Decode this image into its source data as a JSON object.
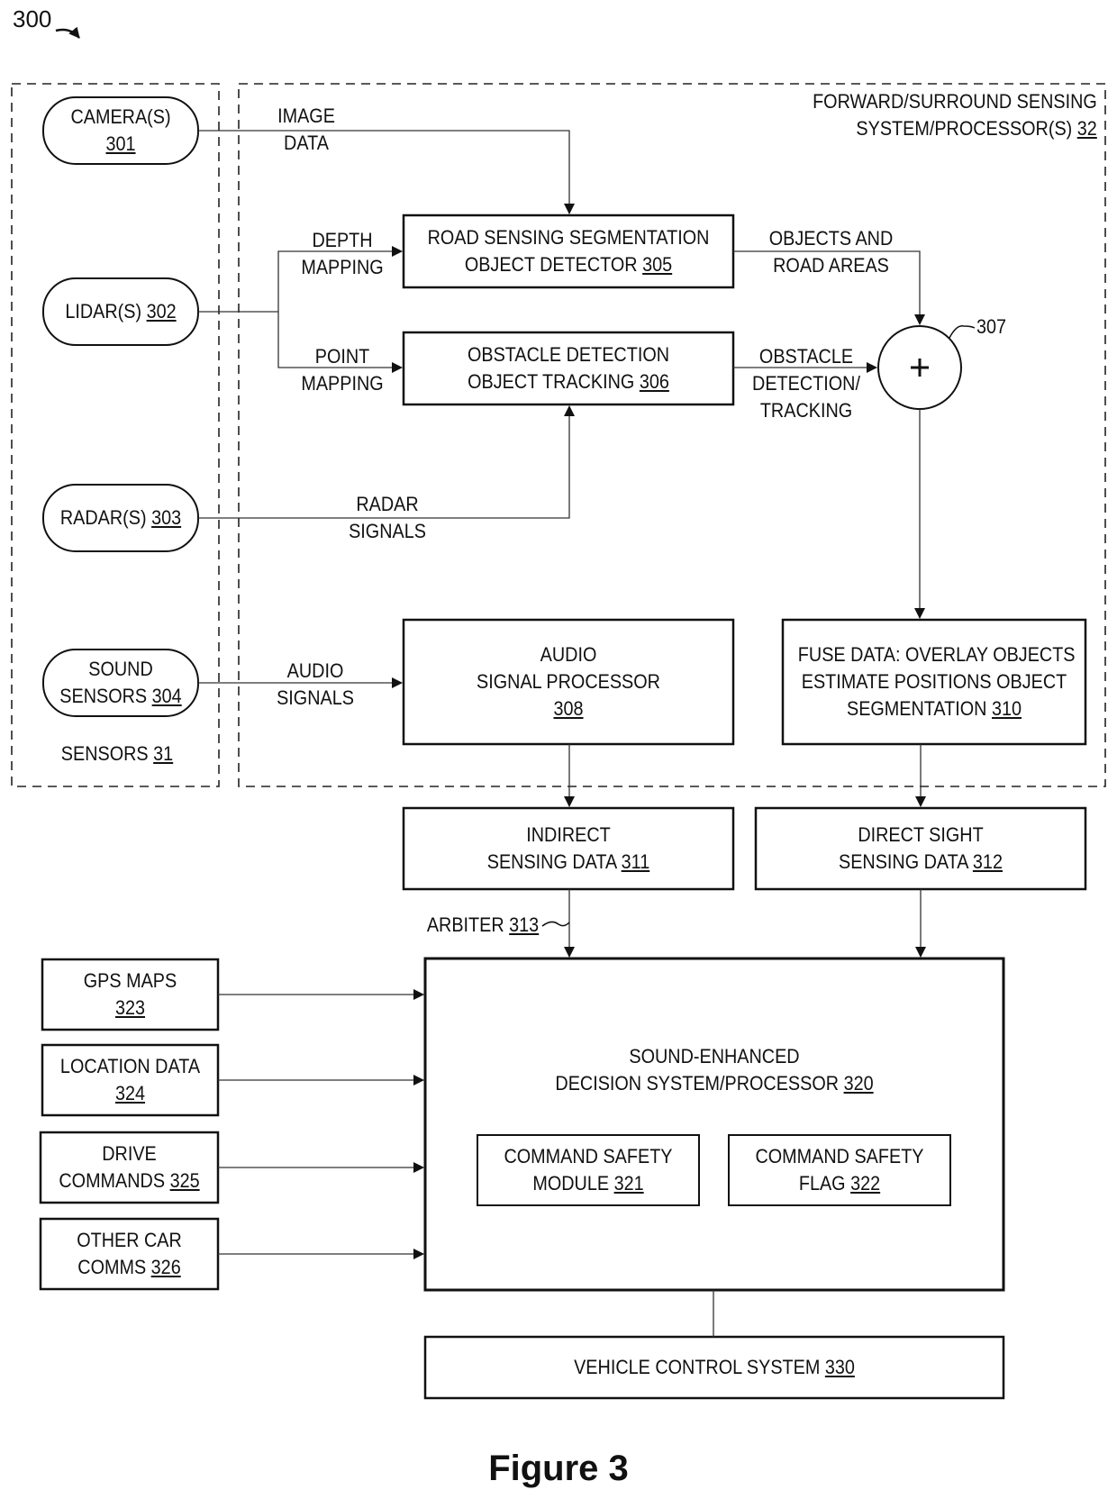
{
  "figure": {
    "number_label": "300",
    "title": "Figure 3"
  },
  "groups": {
    "sensors": {
      "label": "SENSORS",
      "ref": "31"
    },
    "forward_surround": {
      "line1": "FORWARD/SURROUND SENSING",
      "line2": "SYSTEM/PROCESSOR(S)",
      "ref": "32"
    }
  },
  "sensors": [
    {
      "id": "camera",
      "line1": "CAMERA(S)",
      "line2": "",
      "ref": "301"
    },
    {
      "id": "lidar",
      "line1": "",
      "line2": "LIDAR(S)",
      "ref": "302"
    },
    {
      "id": "radar",
      "line1": "",
      "line2": "RADAR(S)",
      "ref": "303"
    },
    {
      "id": "sound",
      "line1": "SOUND",
      "line2": "SENSORS",
      "ref": "304"
    }
  ],
  "blocks": {
    "road_sensing": {
      "line1": "ROAD SENSING SEGMENTATION",
      "line2": "OBJECT DETECTOR",
      "ref": "305"
    },
    "obstacle_detection": {
      "line1": "OBSTACLE DETECTION",
      "line2": "OBJECT TRACKING",
      "ref": "306"
    },
    "summer": {
      "symbol": "+",
      "ref": "307"
    },
    "audio_processor": {
      "line1": "AUDIO",
      "line2": "SIGNAL PROCESSOR",
      "ref": "308"
    },
    "fuse_data": {
      "line1": "FUSE DATA: OVERLAY OBJECTS",
      "line2": "ESTIMATE POSITIONS OBJECT",
      "line3": "SEGMENTATION",
      "ref": "310"
    },
    "indirect_sensing": {
      "line1": "INDIRECT",
      "line2": "SENSING DATA",
      "ref": "311"
    },
    "direct_sight": {
      "line1": "DIRECT SIGHT",
      "line2": "SENSING DATA",
      "ref": "312"
    },
    "arbiter": {
      "label": "ARBITER",
      "ref": "313"
    },
    "decision_system": {
      "line1": "SOUND-ENHANCED",
      "line2": "DECISION SYSTEM/PROCESSOR",
      "ref": "320"
    },
    "safety_module": {
      "line1": "COMMAND SAFETY",
      "line2": "MODULE",
      "ref": "321"
    },
    "safety_flag": {
      "line1": "COMMAND SAFETY",
      "line2": "FLAG",
      "ref": "322"
    },
    "vehicle_control": {
      "line1": "VEHICLE CONTROL SYSTEM",
      "ref": "330"
    }
  },
  "inputs": [
    {
      "id": "gps",
      "line1": "GPS MAPS",
      "line2": "",
      "ref": "323"
    },
    {
      "id": "location",
      "line1": "LOCATION DATA",
      "line2": "",
      "ref": "324"
    },
    {
      "id": "drive",
      "line1": "DRIVE",
      "line2": "COMMANDS",
      "ref": "325"
    },
    {
      "id": "comms",
      "line1": "OTHER CAR",
      "line2": "COMMS",
      "ref": "326"
    }
  ],
  "edge_labels": {
    "image_data": [
      "IMAGE",
      "DATA"
    ],
    "depth_mapping": [
      "DEPTH",
      "MAPPING"
    ],
    "point_mapping": [
      "POINT",
      "MAPPING"
    ],
    "objects_road": [
      "OBJECTS AND",
      "ROAD AREAS"
    ],
    "obstacle_tracking": [
      "OBSTACLE",
      "DETECTION/",
      "TRACKING"
    ],
    "radar_signals": [
      "RADAR",
      "SIGNALS"
    ],
    "audio_signals": [
      "AUDIO",
      "SIGNALS"
    ]
  }
}
